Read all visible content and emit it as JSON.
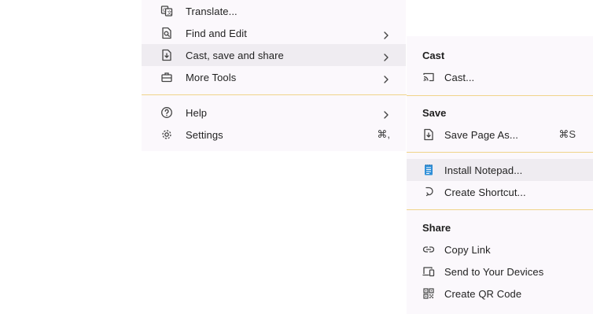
{
  "main_menu": {
    "translate": {
      "label": "Translate...",
      "icon": "translate-icon"
    },
    "find_edit": {
      "label": "Find and Edit",
      "icon": "find-page-icon"
    },
    "cast_save_share": {
      "label": "Cast, save and share",
      "icon": "save-share-icon"
    },
    "more_tools": {
      "label": "More Tools",
      "icon": "toolbox-icon"
    },
    "help": {
      "label": "Help",
      "icon": "help-icon"
    },
    "settings": {
      "label": "Settings",
      "icon": "gear-icon",
      "shortcut": "⌘,"
    }
  },
  "sub_menu": {
    "cast_heading": "Cast",
    "cast": {
      "label": "Cast...",
      "icon": "cast-icon"
    },
    "save_heading": "Save",
    "save_page": {
      "label": "Save Page As...",
      "icon": "save-page-icon",
      "shortcut": "⌘S"
    },
    "install_app": {
      "label": "Install Notepad...",
      "icon": "notepad-app-icon"
    },
    "create_shortcut": {
      "label": "Create Shortcut...",
      "icon": "shortcut-arrow-icon"
    },
    "share_heading": "Share",
    "copy_link": {
      "label": "Copy Link",
      "icon": "link-icon"
    },
    "send_devices": {
      "label": "Send to Your Devices",
      "icon": "devices-icon"
    },
    "qr_code": {
      "label": "Create QR Code",
      "icon": "qr-code-icon"
    }
  },
  "colors": {
    "menu_background": "#fbf8fc",
    "hover_background": "#efecf1",
    "separator": "#f0d48a",
    "notepad_icon": "#2f8fd8"
  }
}
